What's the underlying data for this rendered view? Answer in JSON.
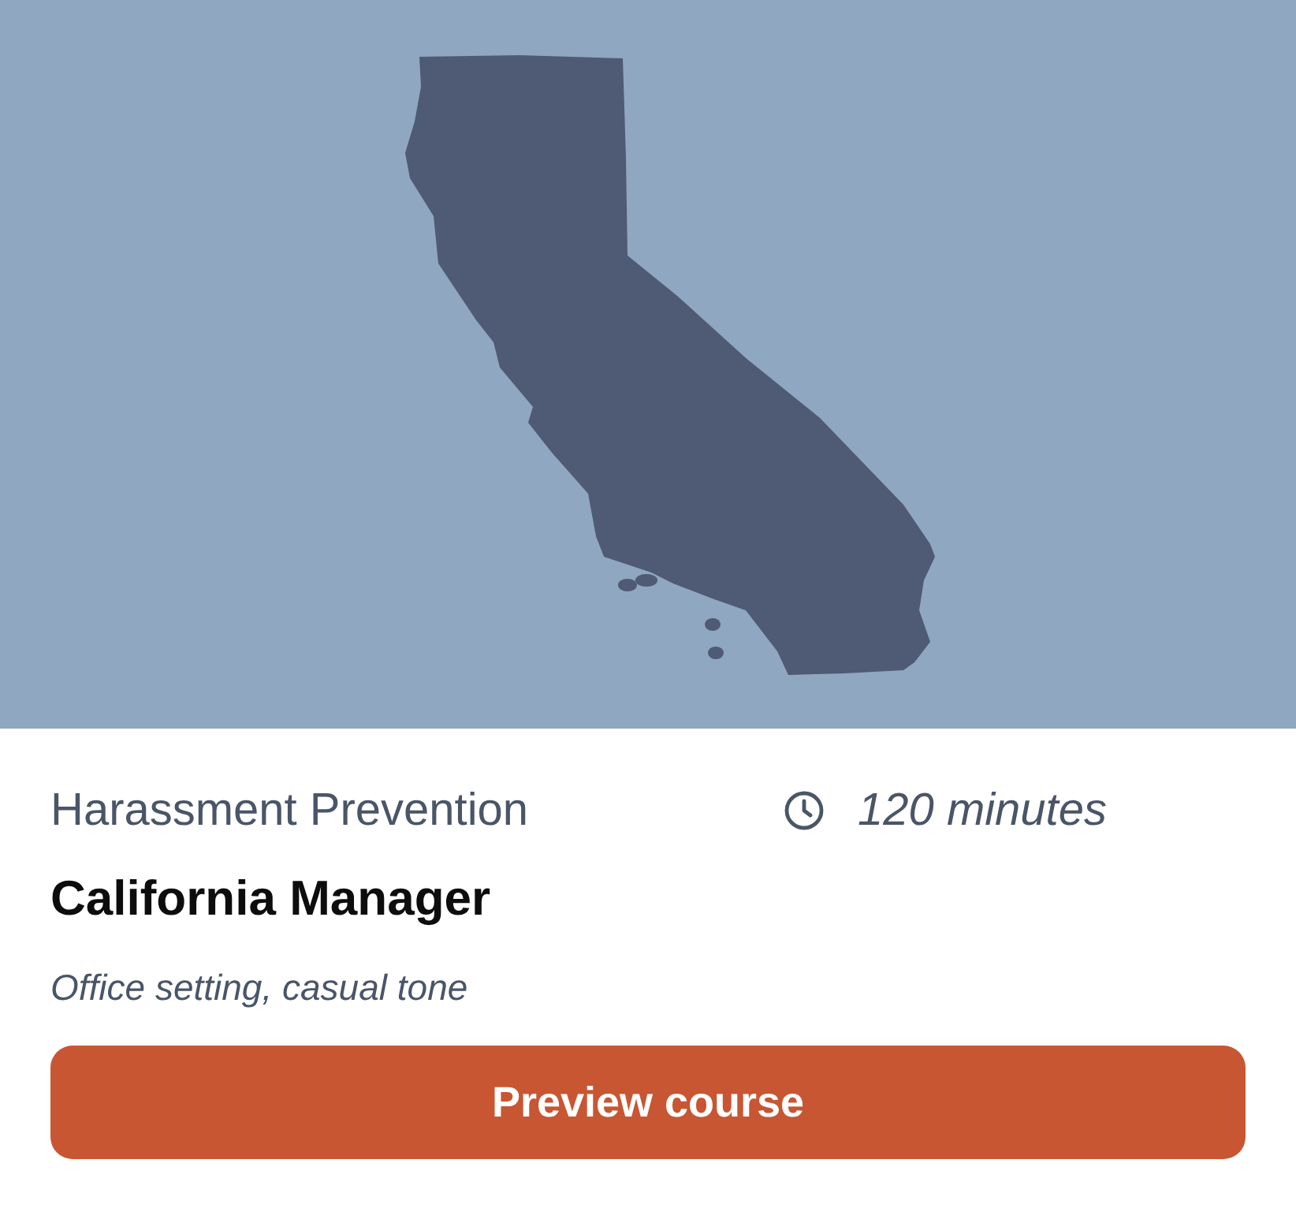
{
  "course": {
    "category": "Harassment Prevention",
    "duration": "120 minutes",
    "title": "California Manager",
    "setting": "Office setting, casual tone"
  },
  "button": {
    "label": "Preview course"
  }
}
